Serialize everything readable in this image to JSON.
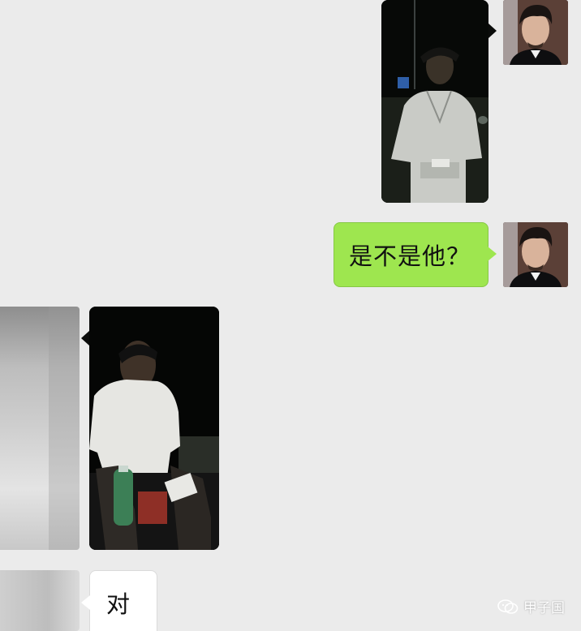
{
  "messages": [
    {
      "side": "right",
      "type": "image",
      "icon": "photo-night-man-standing"
    },
    {
      "side": "right",
      "type": "text",
      "text": "是不是他？"
    },
    {
      "side": "left",
      "type": "image",
      "icon": "photo-night-man-sitting"
    },
    {
      "side": "left",
      "type": "text",
      "text": "对"
    }
  ],
  "watermark": {
    "icon": "wechat-icon",
    "text": "甲子国"
  },
  "colors": {
    "background": "#ebebeb",
    "outgoing_bubble": "#9ee64f",
    "incoming_bubble": "#ffffff"
  }
}
